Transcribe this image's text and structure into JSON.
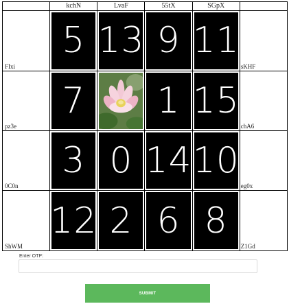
{
  "columns": [
    "kchN",
    "LvaF",
    "55tX",
    "SGpX"
  ],
  "rows": [
    {
      "left": "FIxi",
      "right": "sKHF",
      "tiles": [
        "5",
        "13",
        "9",
        "11"
      ]
    },
    {
      "left": "pz3e",
      "right": "chA6",
      "tiles": [
        "7",
        "",
        "1",
        "15"
      ]
    },
    {
      "left": "0C0n",
      "right": "eg0x",
      "tiles": [
        "3",
        "0",
        "14",
        "10"
      ]
    },
    {
      "left": "ShWM",
      "right": "Z1Gd",
      "tiles": [
        "12",
        "2",
        "6",
        "8"
      ]
    }
  ],
  "image_tile": {
    "row": 1,
    "col": 1,
    "icon": "lotus-flower-image"
  },
  "otp": {
    "label": "Enter OTP:",
    "value": "",
    "placeholder": ""
  },
  "submit_label": "SUBMIT",
  "colors": {
    "tile_bg": "#000000",
    "tile_text": "#ffffff",
    "submit_bg": "#5cb85c"
  }
}
